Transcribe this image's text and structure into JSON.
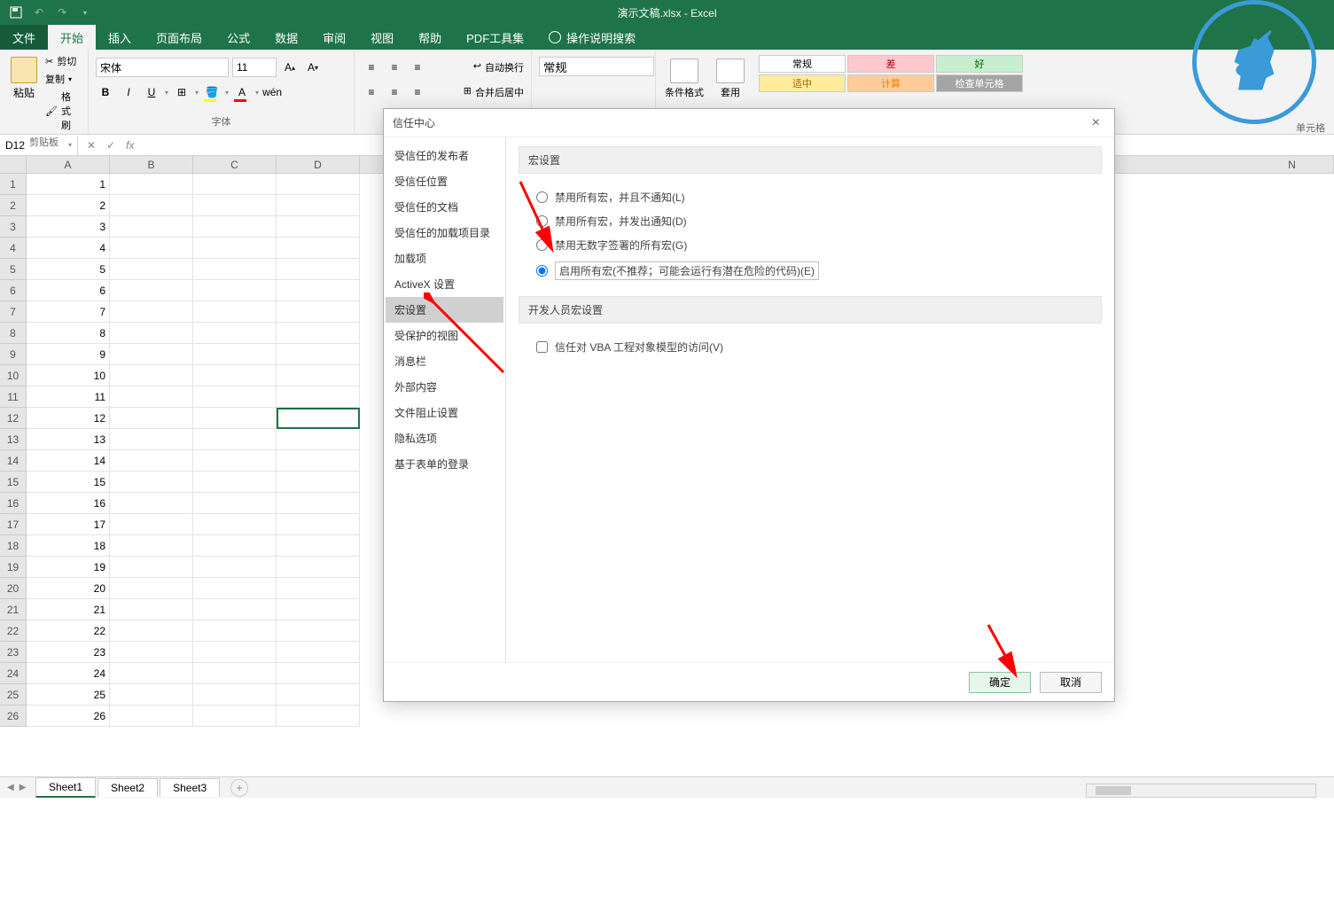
{
  "title": "演示文稿.xlsx - Excel",
  "ribbon": {
    "tabs": {
      "file": "文件",
      "home": "开始",
      "insert": "插入",
      "layout": "页面布局",
      "formulas": "公式",
      "data": "数据",
      "review": "审阅",
      "view": "视图",
      "help": "帮助",
      "pdftools": "PDF工具集",
      "tellme": "操作说明搜索"
    },
    "clipboard": {
      "paste": "粘贴",
      "cut": "剪切",
      "copy": "复制",
      "format_painter": "格式刷",
      "group_label": "剪贴板"
    },
    "font": {
      "name": "宋体",
      "size": "11",
      "group_label": "字体"
    },
    "align": {
      "wrap": "自动换行",
      "merge": "合并后居中"
    },
    "number": {
      "format": "常规"
    },
    "styles": {
      "cond_format": "条件格式",
      "as_table": "套用",
      "normal": "常规",
      "medium": "适中",
      "bad": "差",
      "calc": "计算",
      "good": "好",
      "check": "检查单元格",
      "cell_style_label": "单元格"
    }
  },
  "formula_bar": {
    "name_box": "D12",
    "fx": "fx"
  },
  "grid": {
    "columns": [
      "A",
      "B",
      "C",
      "D",
      "N"
    ],
    "rows": [
      {
        "n": 1,
        "a": "1"
      },
      {
        "n": 2,
        "a": "2"
      },
      {
        "n": 3,
        "a": "3"
      },
      {
        "n": 4,
        "a": "4"
      },
      {
        "n": 5,
        "a": "5"
      },
      {
        "n": 6,
        "a": "6"
      },
      {
        "n": 7,
        "a": "7"
      },
      {
        "n": 8,
        "a": "8"
      },
      {
        "n": 9,
        "a": "9"
      },
      {
        "n": 10,
        "a": "10"
      },
      {
        "n": 11,
        "a": "11"
      },
      {
        "n": 12,
        "a": "12"
      },
      {
        "n": 13,
        "a": "13"
      },
      {
        "n": 14,
        "a": "14"
      },
      {
        "n": 15,
        "a": "15"
      },
      {
        "n": 16,
        "a": "16"
      },
      {
        "n": 17,
        "a": "17"
      },
      {
        "n": 18,
        "a": "18"
      },
      {
        "n": 19,
        "a": "19"
      },
      {
        "n": 20,
        "a": "20"
      },
      {
        "n": 21,
        "a": "21"
      },
      {
        "n": 22,
        "a": "22"
      },
      {
        "n": 23,
        "a": "23"
      },
      {
        "n": 24,
        "a": "24"
      },
      {
        "n": 25,
        "a": "25"
      },
      {
        "n": 26,
        "a": "26"
      }
    ]
  },
  "sheets": {
    "s1": "Sheet1",
    "s2": "Sheet2",
    "s3": "Sheet3"
  },
  "dialog": {
    "title": "信任中心",
    "sidebar": {
      "trusted_publishers": "受信任的发布者",
      "trusted_locations": "受信任位置",
      "trusted_documents": "受信任的文档",
      "trusted_addin_catalogs": "受信任的加载项目录",
      "addins": "加载项",
      "activex": "ActiveX 设置",
      "macro_settings": "宏设置",
      "protected_view": "受保护的视图",
      "message_bar": "消息栏",
      "external_content": "外部内容",
      "file_block": "文件阻止设置",
      "privacy": "隐私选项",
      "form_login": "基于表单的登录"
    },
    "macro_section": {
      "header": "宏设置",
      "opt_disable_no_notify": "禁用所有宏，并且不通知(L)",
      "opt_disable_notify": "禁用所有宏，并发出通知(D)",
      "opt_disable_unsigned": "禁用无数字签署的所有宏(G)",
      "opt_enable_all": "启用所有宏(不推荐；可能会运行有潜在危险的代码)(E)"
    },
    "dev_section": {
      "header": "开发人员宏设置",
      "trust_vba": "信任对 VBA 工程对象模型的访问(V)"
    },
    "buttons": {
      "ok": "确定",
      "cancel": "取消"
    }
  }
}
